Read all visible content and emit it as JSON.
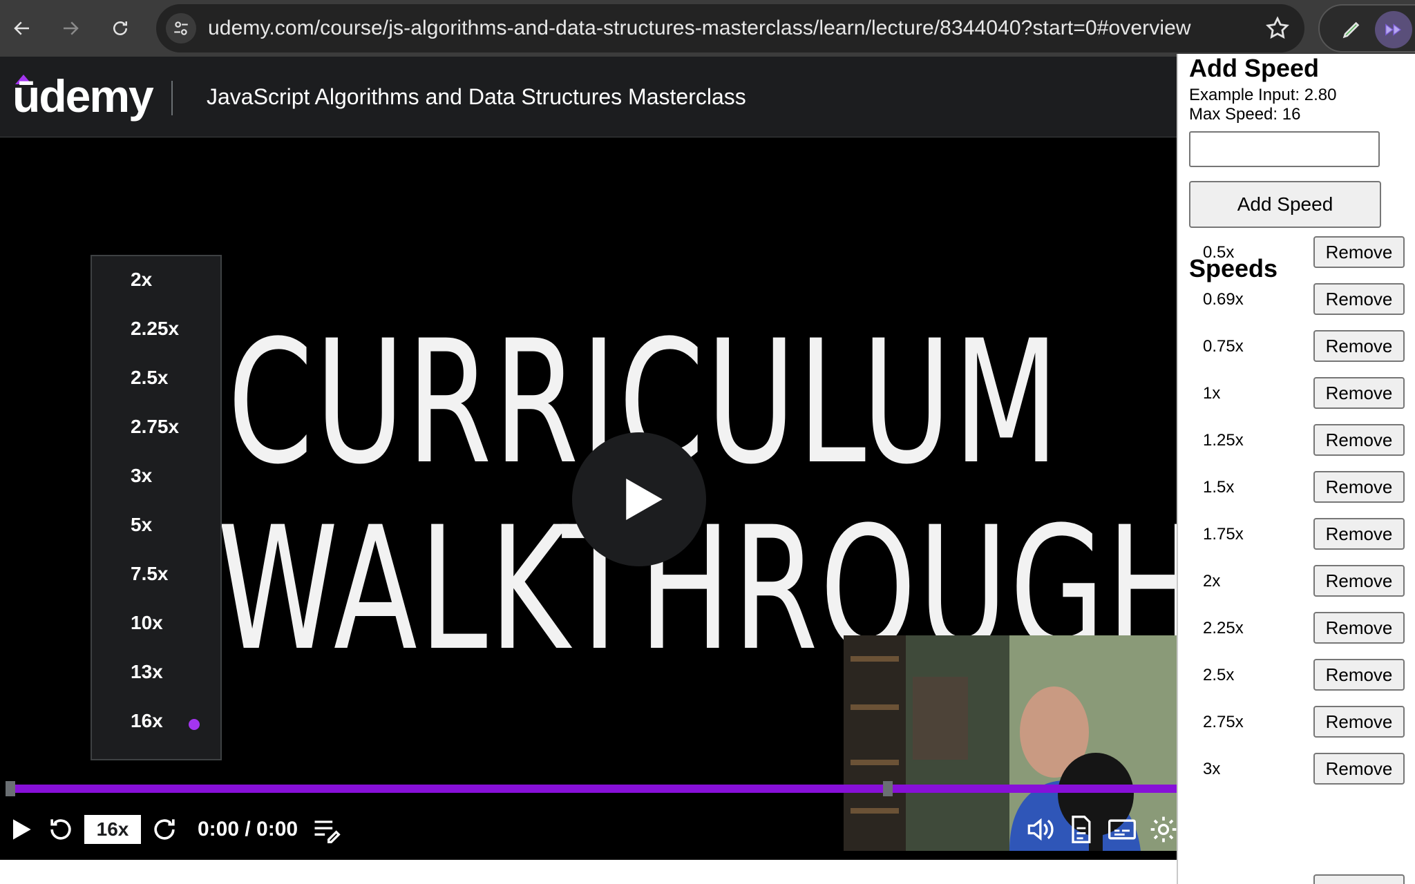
{
  "browser": {
    "url": "udemy.com/course/js-algorithms-and-data-structures-masterclass/learn/lecture/8344040?start=0#overview"
  },
  "header": {
    "logo": "ūdemy",
    "course_title": "JavaScript Algorithms and Data Structures Masterclass"
  },
  "video": {
    "title_line1": "CURRICULUM",
    "title_line2": "WALKTHROUGH",
    "speed_menu": {
      "options": [
        "2x",
        "2.25x",
        "2.5x",
        "2.75x",
        "3x",
        "5x",
        "7.5x",
        "10x",
        "13x",
        "16x"
      ],
      "selected": "16x"
    },
    "progress_fraction": 1.0
  },
  "controls": {
    "rate_label": "16x",
    "time": "0:00 / 0:00"
  },
  "popup": {
    "title": "Add Speed",
    "example_input": "Example Input: 2.80",
    "max_speed": "Max Speed: 16",
    "input_value": "",
    "add_button": "Add Speed",
    "speeds_heading": "Speeds",
    "remove_label": "Remove",
    "speeds": [
      "0.5x",
      "0.69x",
      "0.75x",
      "1x",
      "1.25x",
      "1.5x",
      "1.75x",
      "2x",
      "2.25x",
      "2.5x",
      "2.75x",
      "3x"
    ]
  },
  "colors": {
    "accent": "#a435f0",
    "progress": "#8710d8",
    "header_bg": "#1c1d1f"
  },
  "icons": {
    "back": "arrow-left-icon",
    "forward": "arrow-right-icon",
    "reload": "reload-icon",
    "site_info": "tune-icon",
    "bookmark": "star-icon",
    "extension_pen": "pen-icon",
    "extension_speed": "fast-forward-icon",
    "play": "play-icon",
    "rewind": "rewind-5-icon",
    "forward_skip": "forward-5-icon",
    "notes": "notes-icon",
    "volume": "volume-icon",
    "transcript": "transcript-icon",
    "captions": "captions-icon",
    "settings": "gear-icon"
  }
}
